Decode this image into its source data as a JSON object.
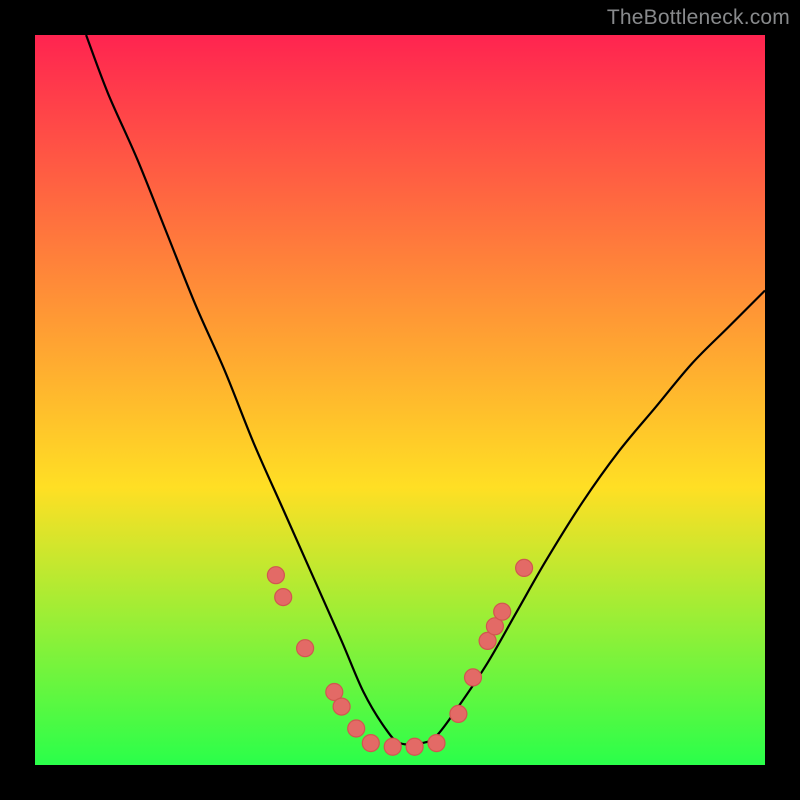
{
  "watermark": "TheBottleneck.com",
  "chart_data": {
    "type": "line",
    "title": "",
    "xlabel": "",
    "ylabel": "",
    "xlim": [
      0,
      100
    ],
    "ylim": [
      0,
      100
    ],
    "grid": false,
    "legend": false,
    "background_gradient": {
      "stops": [
        "#ff2450",
        "#ffdf24",
        "#2aff4a"
      ],
      "positions": [
        0,
        0.62,
        1
      ]
    },
    "green_band_threshold_y": 5,
    "series": [
      {
        "name": "bottleneck-curve",
        "x": [
          7,
          10,
          14,
          18,
          22,
          26,
          30,
          34,
          38,
          42,
          45,
          48,
          50,
          53,
          55,
          58,
          62,
          66,
          70,
          75,
          80,
          85,
          90,
          95,
          100
        ],
        "y": [
          100,
          92,
          83,
          73,
          63,
          54,
          44,
          35,
          26,
          17,
          10,
          5,
          3,
          3,
          4,
          8,
          14,
          21,
          28,
          36,
          43,
          49,
          55,
          60,
          65
        ]
      }
    ],
    "markers": [
      {
        "x": 33,
        "y": 26
      },
      {
        "x": 34,
        "y": 23
      },
      {
        "x": 37,
        "y": 16
      },
      {
        "x": 41,
        "y": 10
      },
      {
        "x": 42,
        "y": 8
      },
      {
        "x": 44,
        "y": 5
      },
      {
        "x": 46,
        "y": 3
      },
      {
        "x": 49,
        "y": 2.5
      },
      {
        "x": 52,
        "y": 2.5
      },
      {
        "x": 55,
        "y": 3
      },
      {
        "x": 58,
        "y": 7
      },
      {
        "x": 60,
        "y": 12
      },
      {
        "x": 62,
        "y": 17
      },
      {
        "x": 63,
        "y": 19
      },
      {
        "x": 64,
        "y": 21
      },
      {
        "x": 67,
        "y": 27
      }
    ],
    "marker_radius_px": 8.5
  }
}
